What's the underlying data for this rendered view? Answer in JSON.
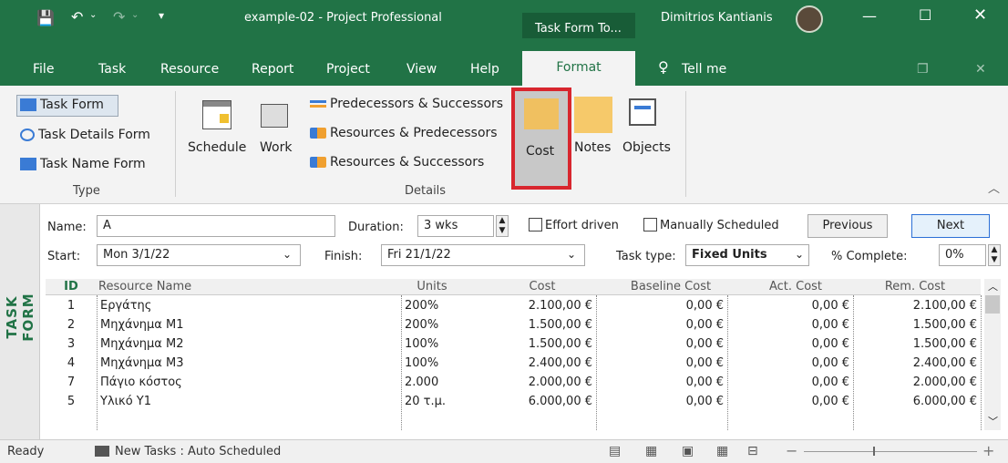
{
  "titlebar": {
    "title": "example-02  -  Project Professional",
    "context_tab": "Task Form To...",
    "user": "Dimitrios Kantianis",
    "accent": "#217346"
  },
  "tabs": [
    "File",
    "Task",
    "Resource",
    "Report",
    "Project",
    "View",
    "Help"
  ],
  "format_tab": "Format",
  "tell_me": "Tell me",
  "ribbon": {
    "type_group": {
      "label": "Type",
      "task_form": "Task Form",
      "task_details_form": "Task Details Form",
      "task_name_form": "Task Name Form"
    },
    "details_group": {
      "label": "Details",
      "schedule": "Schedule",
      "work": "Work",
      "pred_succ": "Predecessors & Successors",
      "res_pred": "Resources & Predecessors",
      "res_succ": "Resources & Successors",
      "cost": "Cost",
      "notes": "Notes",
      "objects": "Objects"
    }
  },
  "side_label": "TASK FORM",
  "form": {
    "name_label": "Name:",
    "name_value": "A",
    "duration_label": "Duration:",
    "duration_value": "3 wks",
    "effort_driven": "Effort driven",
    "manually_scheduled": "Manually Scheduled",
    "previous": "Previous",
    "next": "Next",
    "start_label": "Start:",
    "start_value": "Mon 3/1/22",
    "finish_label": "Finish:",
    "finish_value": "Fri 21/1/22",
    "task_type_label": "Task type:",
    "task_type_value": "Fixed Units",
    "complete_label": "% Complete:",
    "complete_value": "0%"
  },
  "grid": {
    "headers": [
      "ID",
      "Resource Name",
      "Units",
      "Cost",
      "Baseline Cost",
      "Act. Cost",
      "Rem. Cost"
    ],
    "rows": [
      {
        "id": "1",
        "name": "Εργάτης",
        "units": "200%",
        "cost": "2.100,00 €",
        "baseline": "0,00 €",
        "act": "0,00 €",
        "rem": "2.100,00 €"
      },
      {
        "id": "2",
        "name": "Μηχάνημα Μ1",
        "units": "200%",
        "cost": "1.500,00 €",
        "baseline": "0,00 €",
        "act": "0,00 €",
        "rem": "1.500,00 €"
      },
      {
        "id": "3",
        "name": "Μηχάνημα Μ2",
        "units": "100%",
        "cost": "1.500,00 €",
        "baseline": "0,00 €",
        "act": "0,00 €",
        "rem": "1.500,00 €"
      },
      {
        "id": "4",
        "name": "Μηχάνημα Μ3",
        "units": "100%",
        "cost": "2.400,00 €",
        "baseline": "0,00 €",
        "act": "0,00 €",
        "rem": "2.400,00 €"
      },
      {
        "id": "7",
        "name": "Πάγιο κόστος",
        "units": "2.000",
        "cost": "2.000,00 €",
        "baseline": "0,00 €",
        "act": "0,00 €",
        "rem": "2.000,00 €"
      },
      {
        "id": "5",
        "name": "Υλικό Υ1",
        "units": "20 τ.μ.",
        "cost": "6.000,00 €",
        "baseline": "0,00 €",
        "act": "0,00 €",
        "rem": "6.000,00 €"
      }
    ]
  },
  "status": {
    "ready": "Ready",
    "new_tasks": "New Tasks : Auto Scheduled"
  }
}
